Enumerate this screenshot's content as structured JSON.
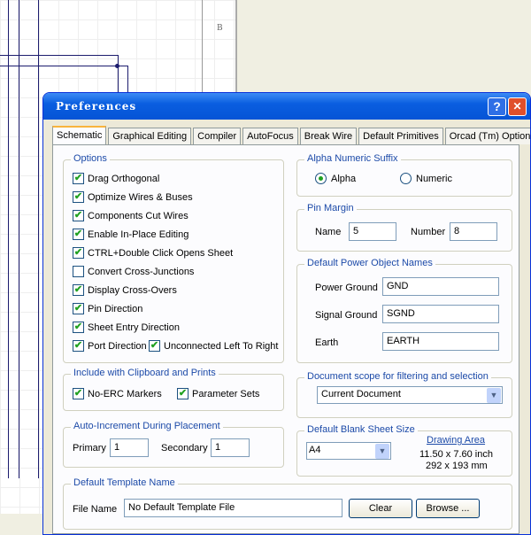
{
  "background": {
    "sheet_zone_label": "B"
  },
  "dialog": {
    "title": "Preferences",
    "help": "?",
    "close": "✕"
  },
  "tabs": [
    "Schematic",
    "Graphical Editing",
    "Compiler",
    "AutoFocus",
    "Break Wire",
    "Default Primitives",
    "Orcad (Tm) Options"
  ],
  "options": {
    "title": "Options",
    "items": [
      {
        "label": "Drag Orthogonal",
        "checked": true
      },
      {
        "label": "Optimize Wires & Buses",
        "checked": true
      },
      {
        "label": "Components Cut Wires",
        "checked": true
      },
      {
        "label": "Enable In-Place Editing",
        "checked": true
      },
      {
        "label": "CTRL+Double Click Opens Sheet",
        "checked": true
      },
      {
        "label": "Convert Cross-Junctions",
        "checked": false
      },
      {
        "label": "Display Cross-Overs",
        "checked": true
      },
      {
        "label": "Pin Direction",
        "checked": true
      },
      {
        "label": "Sheet Entry Direction",
        "checked": true
      },
      {
        "label": "Port Direction",
        "checked": true
      },
      {
        "label": "Unconnected Left To Right",
        "checked": true
      }
    ]
  },
  "clipboard": {
    "title": "Include with Clipboard and Prints",
    "no_erc": "No-ERC Markers",
    "param_sets": "Parameter Sets"
  },
  "auto_increment": {
    "title": "Auto-Increment During Placement",
    "primary_label": "Primary",
    "primary": "1",
    "secondary_label": "Secondary",
    "secondary": "1"
  },
  "template": {
    "title": "Default Template Name",
    "file_label": "File Name",
    "file_value": "No Default Template File",
    "clear": "Clear",
    "browse": "Browse ..."
  },
  "suffix": {
    "title": "Alpha Numeric Suffix",
    "alpha": "Alpha",
    "numeric": "Numeric",
    "selected": "Alpha"
  },
  "pin_margin": {
    "title": "Pin Margin",
    "name_label": "Name",
    "name": "5",
    "number_label": "Number",
    "number": "8"
  },
  "power": {
    "title": "Default Power Object Names",
    "power_ground_label": "Power Ground",
    "power_ground": "GND",
    "signal_ground_label": "Signal Ground",
    "signal_ground": "SGND",
    "earth_label": "Earth",
    "earth": "EARTH"
  },
  "scope": {
    "title": "Document scope for filtering and selection",
    "value": "Current Document"
  },
  "sheet_size": {
    "title": "Default Blank Sheet Size",
    "value": "A4",
    "drawing_area": "Drawing Area",
    "inch": "11.50 x 7.60 inch",
    "mm": "292 x 193 mm"
  }
}
